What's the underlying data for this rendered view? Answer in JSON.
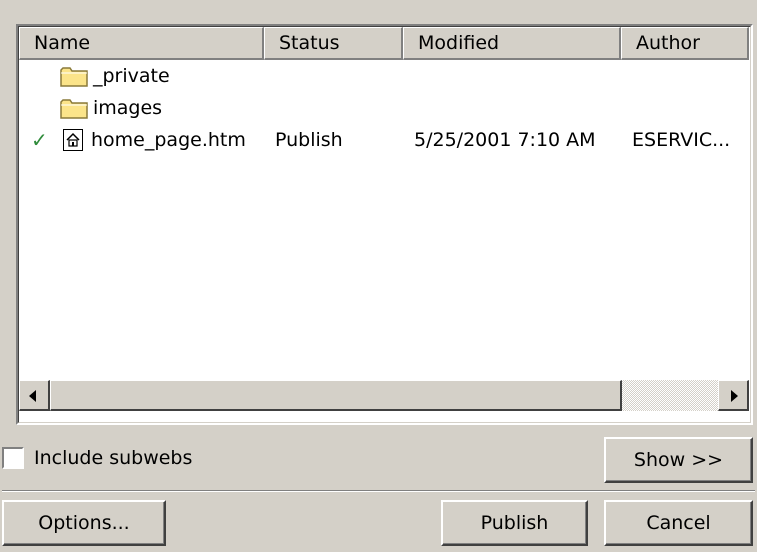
{
  "columns": [
    {
      "label": "Name"
    },
    {
      "label": "Status"
    },
    {
      "label": "Modified"
    },
    {
      "label": "Author"
    }
  ],
  "files": [
    {
      "type": "folder",
      "name": "_private",
      "status": "",
      "modified": "",
      "author": "",
      "checked": false
    },
    {
      "type": "folder",
      "name": "images",
      "status": "",
      "modified": "",
      "author": "",
      "checked": false
    },
    {
      "type": "page",
      "name": "home_page.htm",
      "status": "Publish",
      "modified": "5/25/2001 7:10 AM",
      "author": "ESERVIC...",
      "checked": true
    }
  ],
  "options": {
    "include_subwebs_label": "Include subwebs",
    "include_subwebs_checked": false
  },
  "buttons": {
    "show": "Show >>",
    "options": "Options...",
    "publish": "Publish",
    "cancel": "Cancel"
  },
  "icons": {
    "check": "checkmark-icon",
    "folder": "folder-icon",
    "page": "home-page-icon"
  },
  "colors": {
    "dialog_bg": "#d4d0c8",
    "check": "#2e8b3a",
    "folder": "#fbe48a"
  }
}
